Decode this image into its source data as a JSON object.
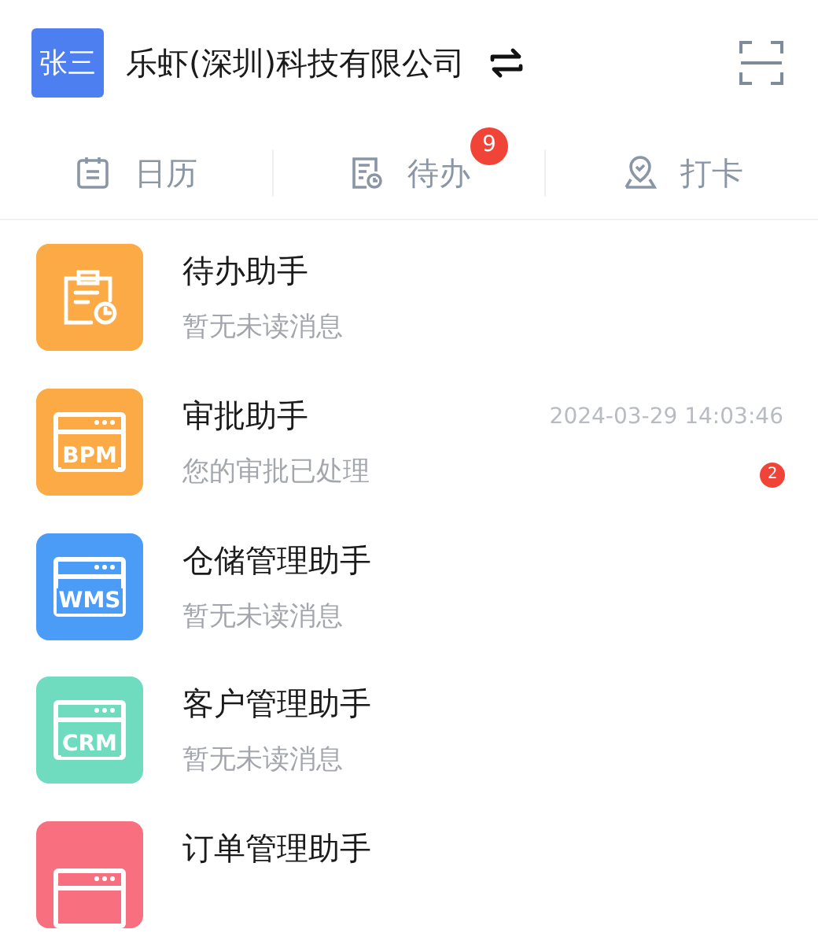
{
  "header": {
    "avatar": "张三",
    "company": "乐虾(深圳)科技有限公司"
  },
  "tabs": [
    {
      "kind": "calendar",
      "label": "日历"
    },
    {
      "kind": "todo",
      "label": "待办",
      "badge": "9"
    },
    {
      "kind": "checkin",
      "label": "打卡"
    }
  ],
  "assistants": [
    {
      "kind": "todo",
      "color": "#fbaa46",
      "title": "待办助手",
      "subtitle": "暂无未读消息"
    },
    {
      "kind": "app",
      "color": "#fbaa46",
      "icon_label": "BPM",
      "title": "审批助手",
      "subtitle": "您的审批已处理",
      "time": "2024-03-29 14:03:46",
      "badge": "2"
    },
    {
      "kind": "app",
      "color": "#4a9cf7",
      "icon_label": "WMS",
      "title": "仓储管理助手",
      "subtitle": "暂无未读消息"
    },
    {
      "kind": "app",
      "color": "#6fdcc0",
      "icon_label": "CRM",
      "title": "客户管理助手",
      "subtitle": "暂无未读消息"
    },
    {
      "kind": "app_cut",
      "color": "#f8707f",
      "title": "订单管理助手"
    }
  ]
}
